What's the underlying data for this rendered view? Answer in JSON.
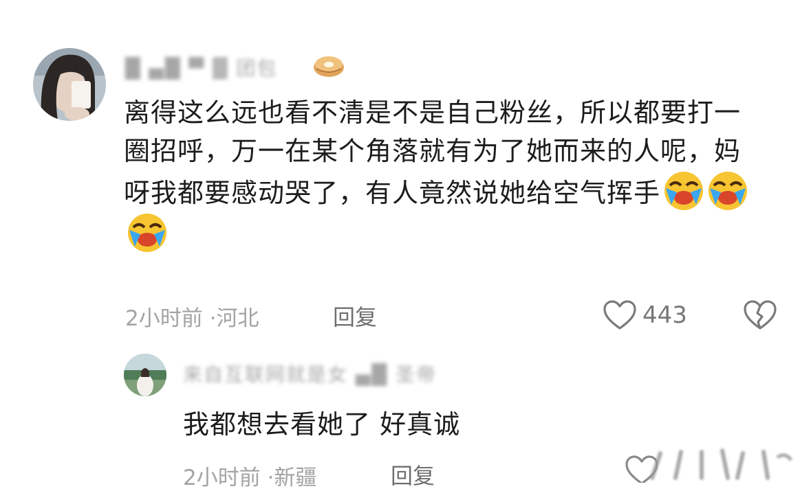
{
  "comment": {
    "username": "█ ▄█ ▀ ▓ 团包",
    "text": "离得这么远也看不清是不是自己粉丝，所以都要打一圈招呼，万一在某个角落就有为了她而来的人呢，妈呀我都要感动哭了，有人竟然说她给空气挥手",
    "time": "2小时前",
    "location": "河北",
    "reply_label": "回复",
    "likes": "443"
  },
  "reply_comment": {
    "username": "来自互联网就是女 ▄█ 圣帝",
    "text": "我都想去看她了 好真诚",
    "time": "2小时前",
    "location": "新疆",
    "reply_label": "回复"
  },
  "icons": {
    "heart": "heart-icon",
    "dislike": "broken-heart-icon",
    "emoji": "laugh-cry-emoji"
  },
  "colors": {
    "text": "#1c1c1c",
    "meta": "#a3a3a3",
    "icon": "#7a7a7a"
  }
}
